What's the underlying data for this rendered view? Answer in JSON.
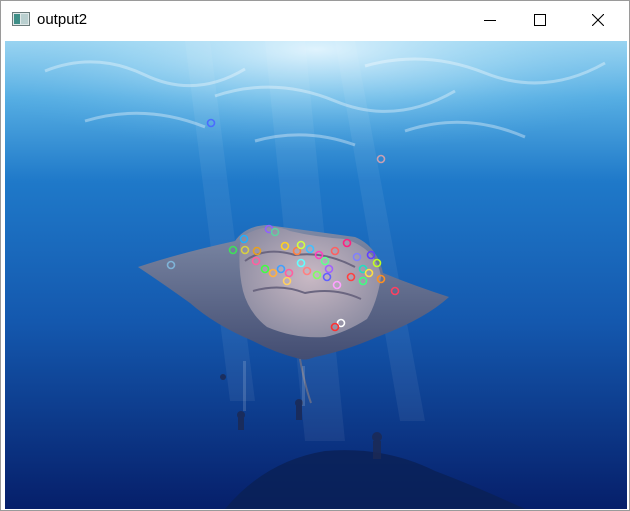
{
  "window": {
    "title": "output2",
    "icon": "image-window-icon",
    "controls": [
      "minimize-icon",
      "maximize-icon",
      "close-icon"
    ]
  },
  "image": {
    "subject": "manta-ray-underwater",
    "colors": {
      "water_top": "#7cc4ea",
      "water_mid": "#1660b6",
      "water_deep": "#061f6a"
    }
  }
}
